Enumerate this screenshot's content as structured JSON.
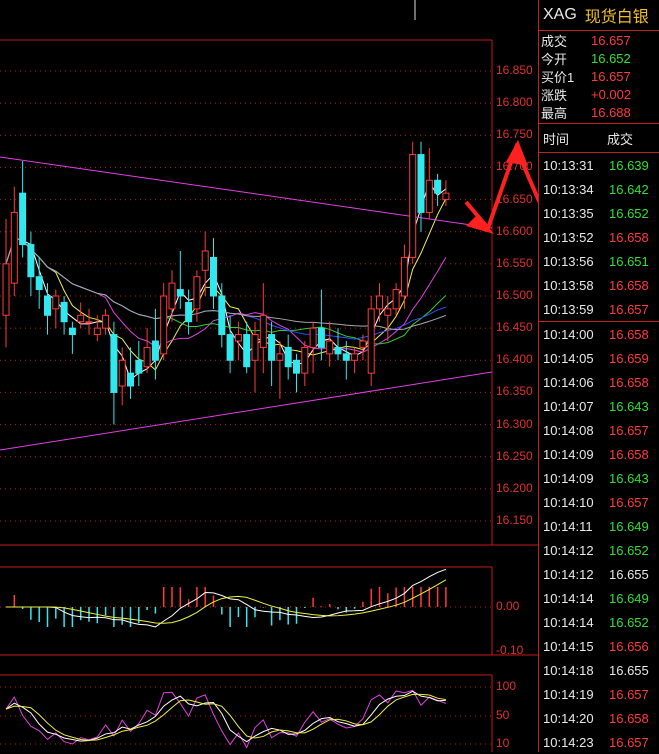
{
  "symbol": "XAG",
  "name": "现货白银",
  "quote": [
    {
      "label": "成交",
      "value": "16.657",
      "color": "red"
    },
    {
      "label": "今开",
      "value": "16.652",
      "color": "green"
    },
    {
      "label": "买价1",
      "value": "16.657",
      "color": "red"
    },
    {
      "label": "涨跌",
      "value": "+0.002",
      "color": "red"
    },
    {
      "label": "最高",
      "value": "16.688",
      "color": "red"
    }
  ],
  "trades_header": {
    "time": "时间",
    "price": "成交"
  },
  "trades": [
    {
      "time": "10:13:31",
      "price": "16.639",
      "color": "green"
    },
    {
      "time": "10:13:34",
      "price": "16.642",
      "color": "green"
    },
    {
      "time": "10:13:35",
      "price": "16.652",
      "color": "green"
    },
    {
      "time": "10:13:52",
      "price": "16.658",
      "color": "red"
    },
    {
      "time": "10:13:56",
      "price": "16.651",
      "color": "green"
    },
    {
      "time": "10:13:58",
      "price": "16.658",
      "color": "red"
    },
    {
      "time": "10:13:59",
      "price": "16.657",
      "color": "red"
    },
    {
      "time": "10:14:00",
      "price": "16.658",
      "color": "red"
    },
    {
      "time": "10:14:05",
      "price": "16.659",
      "color": "red"
    },
    {
      "time": "10:14:06",
      "price": "16.658",
      "color": "red"
    },
    {
      "time": "10:14:07",
      "price": "16.643",
      "color": "green"
    },
    {
      "time": "10:14:08",
      "price": "16.657",
      "color": "red"
    },
    {
      "time": "10:14:09",
      "price": "16.658",
      "color": "red"
    },
    {
      "time": "10:14:09",
      "price": "16.643",
      "color": "green"
    },
    {
      "time": "10:14:10",
      "price": "16.657",
      "color": "red"
    },
    {
      "time": "10:14:11",
      "price": "16.649",
      "color": "green"
    },
    {
      "time": "10:14:12",
      "price": "16.652",
      "color": "green"
    },
    {
      "time": "10:14:12",
      "price": "16.655",
      "color": "white"
    },
    {
      "time": "10:14:14",
      "price": "16.649",
      "color": "green"
    },
    {
      "time": "10:14:14",
      "price": "16.652",
      "color": "green"
    },
    {
      "time": "10:14:15",
      "price": "16.656",
      "color": "red"
    },
    {
      "time": "10:14:18",
      "price": "16.655",
      "color": "white"
    },
    {
      "time": "10:14:19",
      "price": "16.657",
      "color": "red"
    },
    {
      "time": "10:14:20",
      "price": "16.658",
      "color": "red"
    },
    {
      "time": "10:14:23",
      "price": "16.657",
      "color": "red"
    }
  ],
  "price_axis": [
    "16.850",
    "16.800",
    "16.750",
    "16.700",
    "16.650",
    "16.600",
    "16.550",
    "16.500",
    "16.450",
    "16.400",
    "16.350",
    "16.300",
    "16.250",
    "16.200",
    "16.150"
  ],
  "macd_axis": [
    "0.00",
    "-0.10"
  ],
  "kdj_axis": [
    "100",
    "50",
    "10"
  ],
  "chart_data": {
    "type": "candlestick",
    "y_range": [
      16.12,
      16.88
    ],
    "candles": [
      [
        16.47,
        16.62,
        16.42,
        16.55
      ],
      [
        16.52,
        16.67,
        16.5,
        16.63
      ],
      [
        16.66,
        16.71,
        16.56,
        16.58
      ],
      [
        16.58,
        16.6,
        16.5,
        16.53
      ],
      [
        16.53,
        16.56,
        16.48,
        16.51
      ],
      [
        16.5,
        16.52,
        16.44,
        16.47
      ],
      [
        16.48,
        16.51,
        16.45,
        16.5
      ],
      [
        16.49,
        16.5,
        16.44,
        16.46
      ],
      [
        16.45,
        16.46,
        16.41,
        16.44
      ],
      [
        16.46,
        16.49,
        16.45,
        16.47
      ],
      [
        16.46,
        16.48,
        16.44,
        16.46
      ],
      [
        16.44,
        16.47,
        16.43,
        16.45
      ],
      [
        16.45,
        16.48,
        16.44,
        16.47
      ],
      [
        16.44,
        16.46,
        16.3,
        16.35
      ],
      [
        16.36,
        16.42,
        16.33,
        16.4
      ],
      [
        16.38,
        16.42,
        16.34,
        16.36
      ],
      [
        16.4,
        16.43,
        16.36,
        16.38
      ],
      [
        16.39,
        16.45,
        16.38,
        16.42
      ],
      [
        16.43,
        16.48,
        16.37,
        16.4
      ],
      [
        16.41,
        16.52,
        16.4,
        16.5
      ],
      [
        16.48,
        16.54,
        16.46,
        16.52
      ],
      [
        16.51,
        16.57,
        16.48,
        16.5
      ],
      [
        16.49,
        16.51,
        16.44,
        16.46
      ],
      [
        16.48,
        16.54,
        16.46,
        16.53
      ],
      [
        16.54,
        16.6,
        16.5,
        16.57
      ],
      [
        16.56,
        16.59,
        16.48,
        16.5
      ],
      [
        16.5,
        16.52,
        16.42,
        16.44
      ],
      [
        16.44,
        16.47,
        16.38,
        16.4
      ],
      [
        16.43,
        16.46,
        16.4,
        16.44
      ],
      [
        16.44,
        16.46,
        16.38,
        16.39
      ],
      [
        16.4,
        16.46,
        16.35,
        16.44
      ],
      [
        16.42,
        16.52,
        16.38,
        16.47
      ],
      [
        16.44,
        16.46,
        16.36,
        16.4
      ],
      [
        16.4,
        16.43,
        16.34,
        16.41
      ],
      [
        16.42,
        16.44,
        16.37,
        16.39
      ],
      [
        16.4,
        16.41,
        16.35,
        16.38
      ],
      [
        16.38,
        16.43,
        16.36,
        16.42
      ],
      [
        16.42,
        16.46,
        16.38,
        16.45
      ],
      [
        16.45,
        16.51,
        16.4,
        16.42
      ],
      [
        16.41,
        16.46,
        16.39,
        16.43
      ],
      [
        16.42,
        16.45,
        16.4,
        16.41
      ],
      [
        16.41,
        16.43,
        16.37,
        16.4
      ],
      [
        16.4,
        16.42,
        16.38,
        16.41
      ],
      [
        16.42,
        16.44,
        16.4,
        16.43
      ],
      [
        16.38,
        16.5,
        16.36,
        16.48
      ],
      [
        16.48,
        16.52,
        16.46,
        16.5
      ],
      [
        16.47,
        16.5,
        16.43,
        16.48
      ],
      [
        16.48,
        16.52,
        16.47,
        16.51
      ],
      [
        16.5,
        16.58,
        16.48,
        16.56
      ],
      [
        16.56,
        16.74,
        16.55,
        16.72
      ],
      [
        16.72,
        16.74,
        16.6,
        16.63
      ],
      [
        16.63,
        16.73,
        16.62,
        16.68
      ],
      [
        16.68,
        16.69,
        16.64,
        16.66
      ],
      [
        16.65,
        16.68,
        16.64,
        16.66
      ]
    ]
  }
}
